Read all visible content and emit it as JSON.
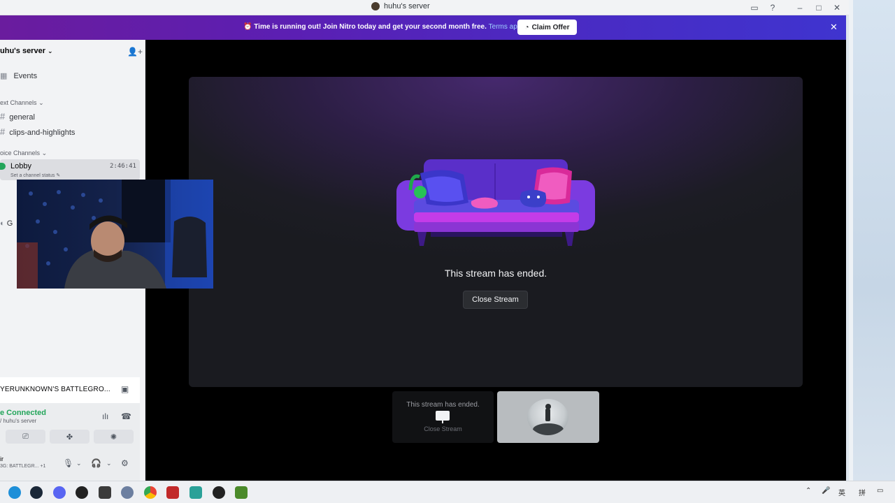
{
  "window": {
    "title": "huhu's server"
  },
  "banner": {
    "message": "Time is running out! Join Nitro today and get your second month free.",
    "link": "Terms apply.",
    "claim_label": "Claim Offer",
    "close_glyph": "✕"
  },
  "sidebar": {
    "server_name": "uhu's server",
    "events_label": "Events",
    "text_category": "ext Channels",
    "channels": [
      "general",
      "clips-and-highlights"
    ],
    "voice_category": "oice Channels",
    "lobby": {
      "name": "Lobby",
      "time": "2:46:41",
      "status": "Set a channel status"
    },
    "partial_channel": "G"
  },
  "voice_panel": {
    "game_title": "YERUNKNOWN'S BATTLEGRO...",
    "status": "e Connected",
    "server": "/ huhu's server",
    "user_name": "ir",
    "user_activity": "3G: BATTLEGR...  +1"
  },
  "stage": {
    "ended_text": "This stream has ended.",
    "close_label": "Close Stream",
    "thumb_ended_text": "This stream has ended.",
    "thumb_close_label": "Close Stream"
  },
  "taskbar": {
    "ime_label": "英",
    "ime_mode": "拼"
  },
  "colors": {
    "accent_connected": "#23a55a",
    "banner_start": "#6a1c9e",
    "banner_end": "#3f34cf",
    "stage_bg": "#000000"
  },
  "icons": {
    "server_dropdown": "chevron-down-icon",
    "invite": "add-user-icon",
    "events": "calendar-icon",
    "hash": "hash-icon",
    "claim": "nitro-icon"
  }
}
